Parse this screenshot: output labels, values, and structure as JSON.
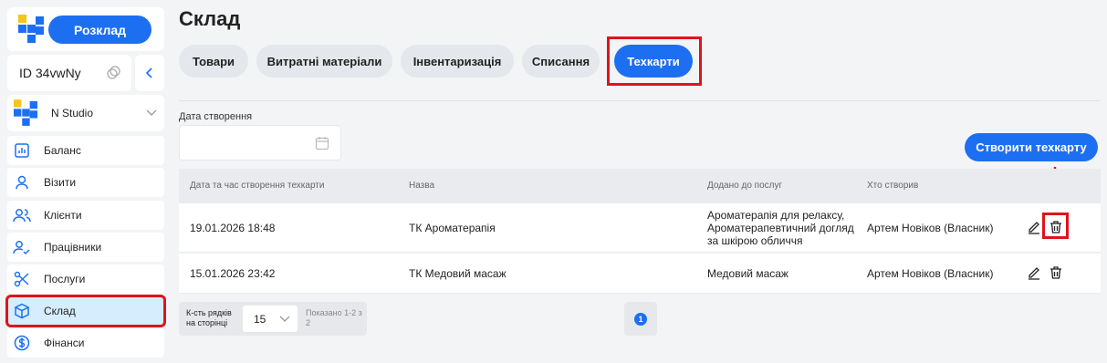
{
  "sidebar": {
    "schedule_button": "Розклад",
    "account_id": "ID 34vwNy",
    "studio_name": "N Studio",
    "items": [
      {
        "label": "Баланс",
        "icon": "chart-icon"
      },
      {
        "label": "Візити",
        "icon": "user-icon"
      },
      {
        "label": "Клієнти",
        "icon": "users-icon"
      },
      {
        "label": "Працівники",
        "icon": "staff-icon"
      },
      {
        "label": "Послуги",
        "icon": "scissors-icon"
      },
      {
        "label": "Склад",
        "icon": "box-icon",
        "active": true
      },
      {
        "label": "Фінанси",
        "icon": "dollar-icon"
      }
    ]
  },
  "main": {
    "title": "Склад",
    "tabs": [
      {
        "label": "Товари"
      },
      {
        "label": "Витратні матеріали"
      },
      {
        "label": "Інвентаризація"
      },
      {
        "label": "Списання"
      },
      {
        "label": "Техкарти",
        "active": true
      }
    ],
    "filter_label": "Дата створення",
    "create_button": "Створити техкарту",
    "table": {
      "headers": [
        "Дата та час створення техкарти",
        "Назва",
        "Додано до послуг",
        "Хто створив"
      ],
      "rows": [
        {
          "date": "19.01.2026 18:48",
          "name": "ТК Ароматерапія",
          "services": [
            "Ароматерапія для релаксу,",
            "Ароматерапевтичний догляд",
            "за шкірою обличчя"
          ],
          "creator": "Артем Новіков (Власник)"
        },
        {
          "date": "15.01.2026 23:42",
          "name": "ТК Медовий масаж",
          "services": [
            "Медовий масаж"
          ],
          "creator": "Артем Новіков (Власник)"
        }
      ]
    },
    "pagination": {
      "rows_per_page_label": "К-сть рядків на сторінці",
      "rows_per_page": "15",
      "shown": "Показано 1-2 з 2",
      "current_page": "1"
    }
  },
  "colors": {
    "accent": "#1d6ff2",
    "highlight": "#e0131a",
    "active_bg": "#d6edfd"
  }
}
